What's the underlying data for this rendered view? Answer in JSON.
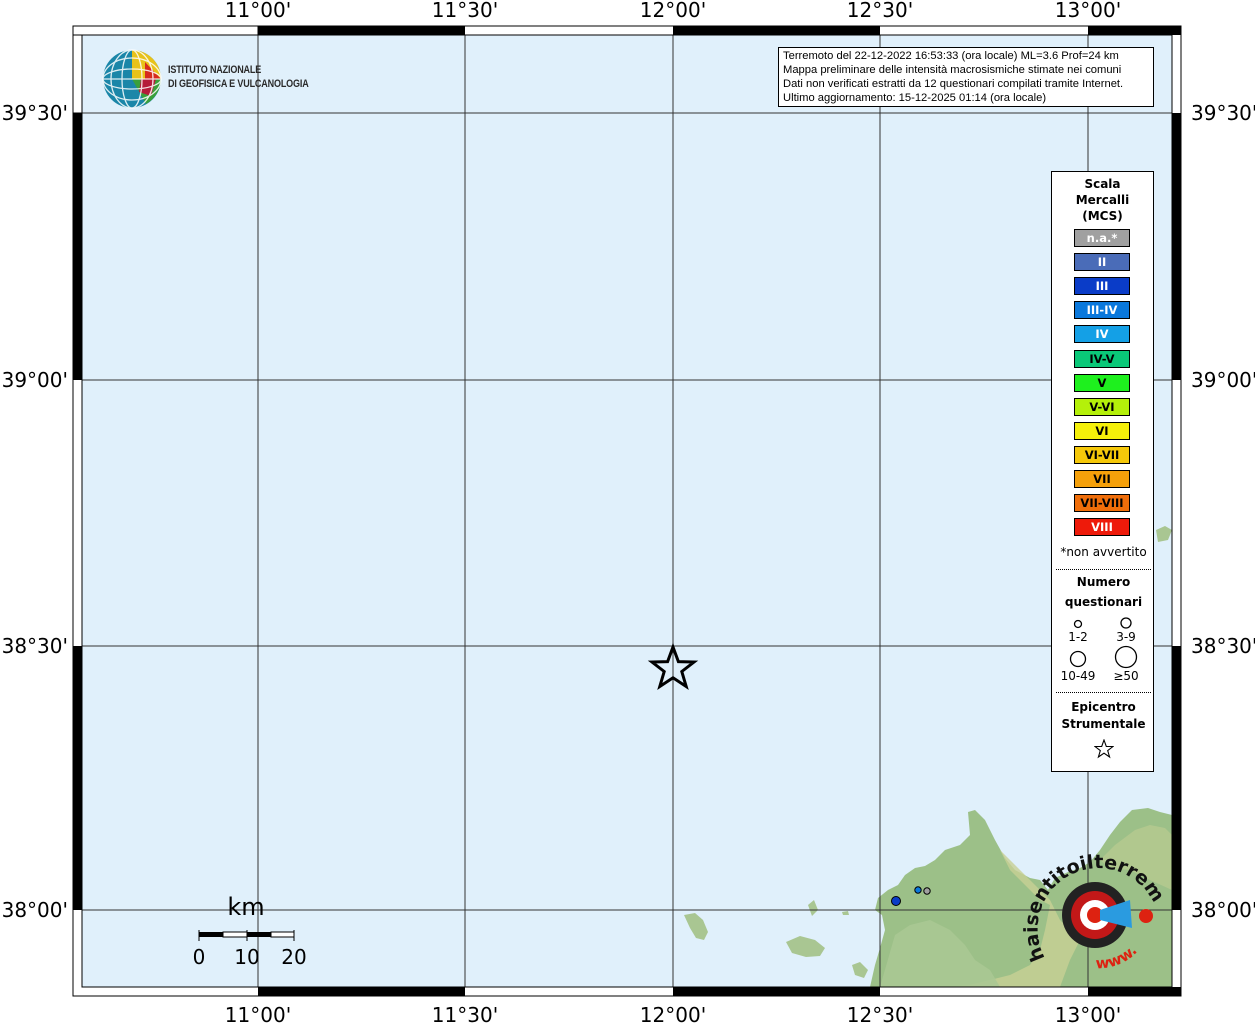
{
  "map": {
    "lon_labels": [
      "11°00'",
      "11°30'",
      "12°00'",
      "12°30'",
      "13°00'"
    ],
    "lat_labels": [
      "39°30'",
      "39°00'",
      "38°30'",
      "38°00'"
    ],
    "sea_color": "#e0f0fb",
    "grid_color": "#333333"
  },
  "logo": {
    "line1": "ISTITUTO NAZIONALE",
    "line2": "DI GEOFISICA E VULCANOLOGIA",
    "icon": "ingv-globe-icon"
  },
  "info": {
    "line1": "Terremoto del 22-12-2022 16:53:33 (ora locale) ML=3.6 Prof=24 km",
    "line2": "Mappa preliminare delle intensità macrosismiche stimate nei comuni",
    "line3": "Dati non verificati estratti da 12 questionari compilati tramite Internet.",
    "line4": "Ultimo aggiornamento: 15-12-2025 01:14 (ora locale)"
  },
  "legend": {
    "title1": "Scala",
    "title2": "Mercalli",
    "title3": "(MCS)",
    "classes": [
      {
        "label": "n.a.*",
        "color": "#a0a0a0",
        "text_color": "#ffffff"
      },
      {
        "label": "II",
        "color": "#4a6cb8",
        "text_color": "#ffffff"
      },
      {
        "label": "III",
        "color": "#0a3cc8",
        "text_color": "#ffffff"
      },
      {
        "label": "III-IV",
        "color": "#0a78dc",
        "text_color": "#ffffff"
      },
      {
        "label": "IV",
        "color": "#14a0e6",
        "text_color": "#ffffff"
      },
      {
        "label": "IV-V",
        "color": "#0ac878",
        "text_color": "#000000"
      },
      {
        "label": "V",
        "color": "#1ef01e",
        "text_color": "#000000"
      },
      {
        "label": "V-VI",
        "color": "#b4f00a",
        "text_color": "#000000"
      },
      {
        "label": "VI",
        "color": "#f5f00a",
        "text_color": "#000000"
      },
      {
        "label": "VI-VII",
        "color": "#f5c80a",
        "text_color": "#000000"
      },
      {
        "label": "VII",
        "color": "#f5a00a",
        "text_color": "#000000"
      },
      {
        "label": "VII-VIII",
        "color": "#f06e0a",
        "text_color": "#000000"
      },
      {
        "label": "VIII",
        "color": "#ee1a0a",
        "text_color": "#ffffff"
      }
    ],
    "note": "*non avvertito",
    "count_title1": "Numero",
    "count_title2": "questionari",
    "count_labels": [
      "1-2",
      "3-9",
      "10-49",
      "≥50"
    ],
    "epi_title1": "Epicentro",
    "epi_title2": "Strumentale"
  },
  "scalebar": {
    "unit": "km",
    "labels": [
      "0",
      "10",
      "20"
    ]
  },
  "watermark": {
    "text_top": "haisentitoilterremoto.it",
    "text_bottom": "www.",
    "icon": "haisentito-logo-icon"
  }
}
